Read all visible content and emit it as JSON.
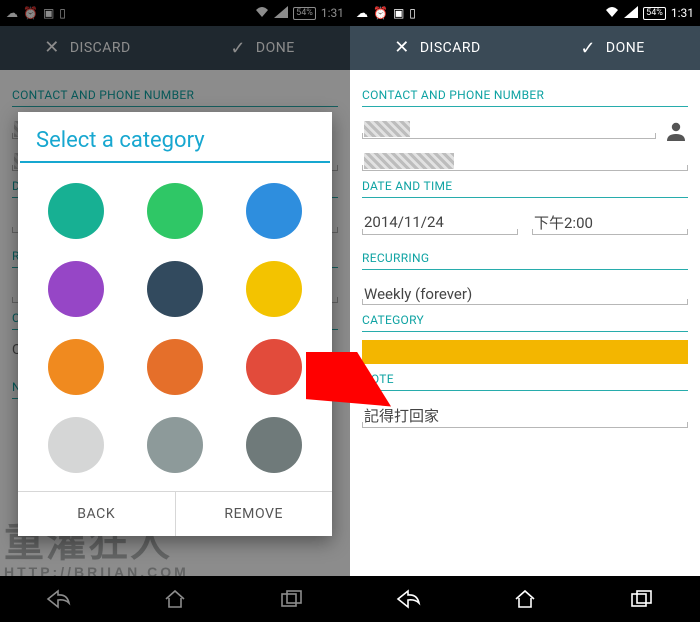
{
  "status": {
    "battery": "54%",
    "time": "1:31"
  },
  "actionbar": {
    "discard": "DISCARD",
    "done": "DONE"
  },
  "sections": {
    "contact": "CONTACT AND PHONE NUMBER",
    "datetime": "DATE AND TIME",
    "recurring": "RECURRING",
    "category": "CATEGORY",
    "note": "NOTE"
  },
  "form": {
    "date": "2014/11/24",
    "time": "下午2:00",
    "recurring": "Weekly (forever)",
    "note": "記得打回家"
  },
  "category_color": "#f3b600",
  "dialog": {
    "title": "Select a category",
    "back": "BACK",
    "remove": "REMOVE",
    "colors": [
      "#17b093",
      "#2fc766",
      "#2e8ede",
      "#9646c6",
      "#324a5e",
      "#f3c300",
      "#f08a1f",
      "#e56f2a",
      "#e24b3b",
      "#d5d6d6",
      "#8d9a9a",
      "#6f7a7a"
    ]
  },
  "watermark": {
    "main": "重灌狂人",
    "sub": "HTTP://BRIIAN.COM"
  }
}
